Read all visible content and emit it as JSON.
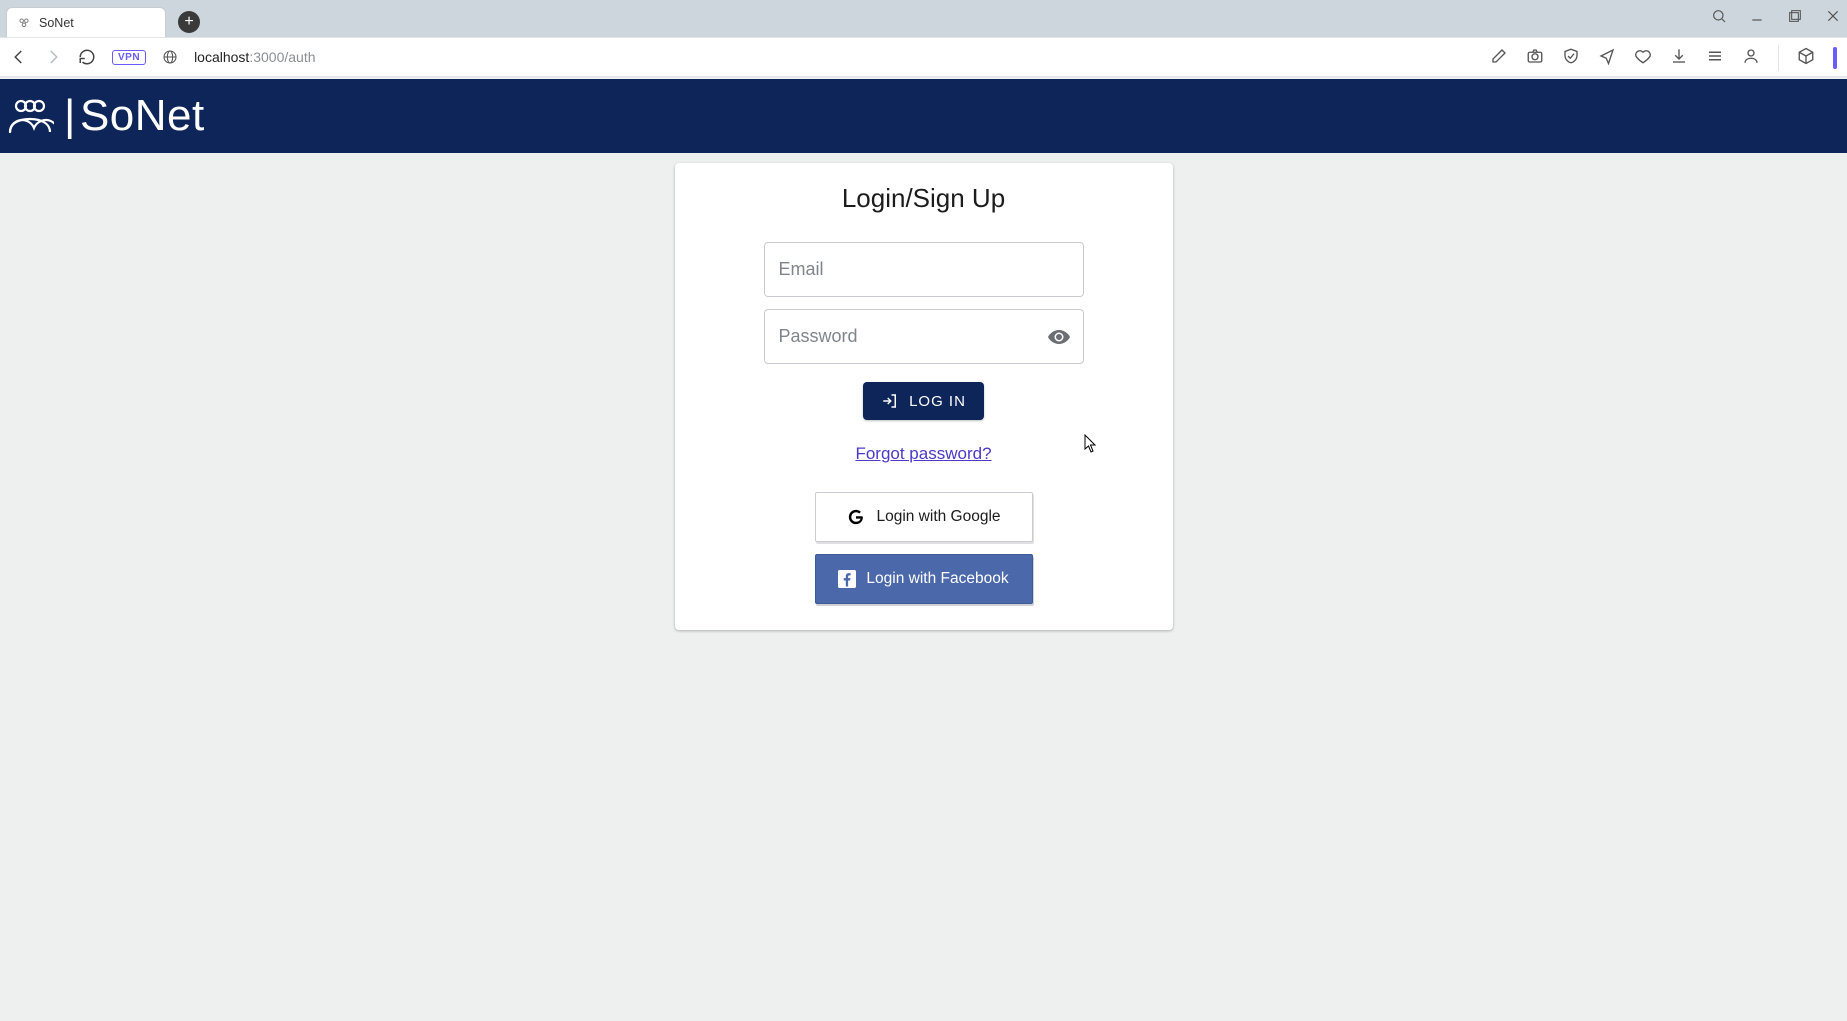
{
  "browser": {
    "tab_title": "SoNet",
    "url_host": "localhost",
    "url_port_path": ":3000/auth",
    "vpn_badge": "VPN"
  },
  "app": {
    "brand": "SoNet"
  },
  "auth_card": {
    "title": "Login/Sign Up",
    "email_placeholder": "Email",
    "password_placeholder": "Password",
    "login_button_label": "LOG IN",
    "forgot_password_label": "Forgot password?",
    "google_button_label": "Login with Google",
    "facebook_button_label": "Login with Facebook"
  },
  "colors": {
    "brand_navy": "#0e2559",
    "link_purple": "#4b39c9",
    "facebook_blue": "#4a68aa"
  }
}
